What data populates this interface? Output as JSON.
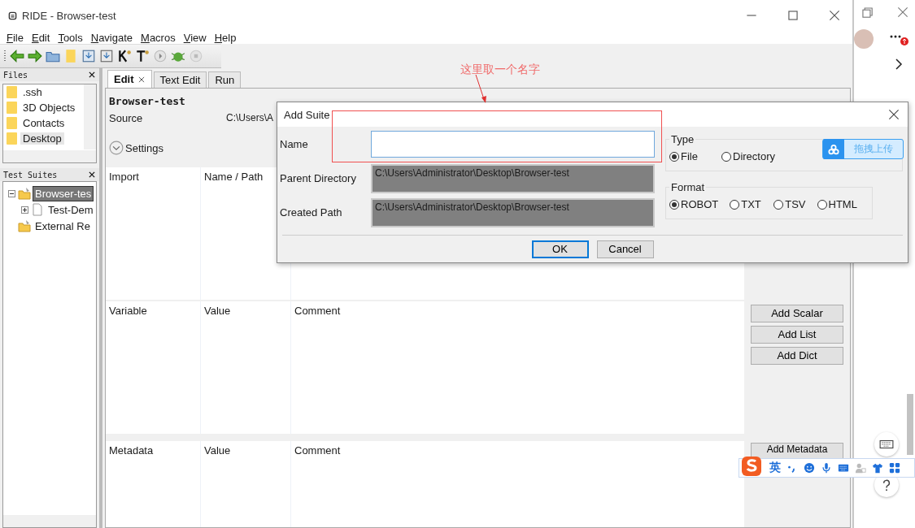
{
  "window": {
    "title": "RIDE - Browser-test"
  },
  "menu": [
    "File",
    "Edit",
    "Tools",
    "Navigate",
    "Macros",
    "View",
    "Help"
  ],
  "files_panel": {
    "title": "Files",
    "items": [
      {
        "label": ".ssh",
        "selected": false
      },
      {
        "label": "3D Objects",
        "selected": false
      },
      {
        "label": "Contacts",
        "selected": false
      },
      {
        "label": "Desktop",
        "selected": true
      }
    ]
  },
  "suites_panel": {
    "title": "Test Suites",
    "tree": [
      {
        "label": "Browser-tes",
        "kind": "suite",
        "selected": true,
        "expanded": true,
        "children": [
          {
            "label": "Test-Dem",
            "kind": "file",
            "selected": false,
            "expanded": false
          }
        ]
      },
      {
        "label": "External Re",
        "kind": "suite",
        "selected": false
      }
    ]
  },
  "tabs": [
    {
      "label": "Edit",
      "selected": true,
      "closable": true
    },
    {
      "label": "Text Edit",
      "selected": false,
      "closable": false
    },
    {
      "label": "Run",
      "selected": false,
      "closable": false
    }
  ],
  "editor": {
    "title": "Browser-test",
    "source_label": "Source",
    "source_value": "C:\\Users\\A",
    "settings_label": "Settings",
    "settings_expanded": false,
    "sections": [
      {
        "columns": [
          "Import",
          "Name / Path"
        ]
      },
      {
        "columns": [
          "Variable",
          "Value",
          "Comment"
        ],
        "buttons": [
          "Add Scalar",
          "Add List",
          "Add Dict"
        ]
      },
      {
        "columns": [
          "Metadata",
          "Value",
          "Comment"
        ],
        "buttons": [
          "Add Metadata"
        ]
      }
    ]
  },
  "dialog": {
    "title": "Add Suite",
    "fields": [
      {
        "label": "Name",
        "kind": "input"
      },
      {
        "label": "Parent Directory",
        "kind": "readonly",
        "value": "C:\\Users\\Administrator\\Desktop\\Browser-test"
      },
      {
        "label": "Created Path",
        "kind": "readonly",
        "value": "C:\\Users\\Administrator\\Desktop\\Browser-test"
      }
    ],
    "type_group": {
      "title": "Type",
      "options": [
        {
          "label": "File",
          "selected": true
        },
        {
          "label": "Directory",
          "selected": false
        }
      ]
    },
    "format_group": {
      "title": "Format",
      "options": [
        {
          "label": "ROBOT",
          "selected": true
        },
        {
          "label": "TXT",
          "selected": false
        },
        {
          "label": "TSV",
          "selected": false
        },
        {
          "label": "HTML",
          "selected": false
        }
      ]
    },
    "buttons": [
      {
        "label": "OK",
        "default": true
      },
      {
        "label": "Cancel",
        "default": false
      }
    ]
  },
  "upload_button": {
    "label": "拖拽上传"
  },
  "annotation": {
    "text": "这里取一个名字"
  },
  "ime_bar": {
    "mode": "英"
  }
}
